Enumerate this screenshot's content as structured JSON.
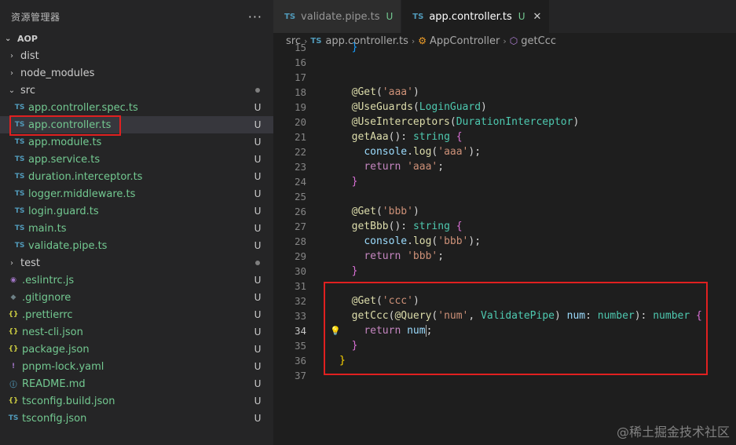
{
  "explorer": {
    "title": "资源管理器",
    "more": "···",
    "root": "AOP",
    "items": [
      {
        "chev": "›",
        "icon": "",
        "label": "dist",
        "status": "",
        "type": "folder"
      },
      {
        "chev": "›",
        "icon": "",
        "label": "node_modules",
        "status": "",
        "type": "folder"
      },
      {
        "chev": "⌄",
        "icon": "",
        "label": "src",
        "status": "dot",
        "type": "folder"
      },
      {
        "chev": "",
        "icon": "TS",
        "label": "app.controller.spec.ts",
        "status": "U",
        "type": "file"
      },
      {
        "chev": "",
        "icon": "TS",
        "label": "app.controller.ts",
        "status": "U",
        "type": "file"
      },
      {
        "chev": "",
        "icon": "TS",
        "label": "app.module.ts",
        "status": "U",
        "type": "file"
      },
      {
        "chev": "",
        "icon": "TS",
        "label": "app.service.ts",
        "status": "U",
        "type": "file"
      },
      {
        "chev": "",
        "icon": "TS",
        "label": "duration.interceptor.ts",
        "status": "U",
        "type": "file"
      },
      {
        "chev": "",
        "icon": "TS",
        "label": "logger.middleware.ts",
        "status": "U",
        "type": "file"
      },
      {
        "chev": "",
        "icon": "TS",
        "label": "login.guard.ts",
        "status": "U",
        "type": "file"
      },
      {
        "chev": "",
        "icon": "TS",
        "label": "main.ts",
        "status": "U",
        "type": "file"
      },
      {
        "chev": "",
        "icon": "TS",
        "label": "validate.pipe.ts",
        "status": "U",
        "type": "file"
      },
      {
        "chev": "›",
        "icon": "",
        "label": "test",
        "status": "dot",
        "type": "folder"
      },
      {
        "chev": "",
        "icon": "◉",
        "label": ".eslintrc.js",
        "status": "U",
        "type": "file"
      },
      {
        "chev": "",
        "icon": "◆",
        "label": ".gitignore",
        "status": "U",
        "type": "file"
      },
      {
        "chev": "",
        "icon": "{}",
        "label": ".prettierrc",
        "status": "U",
        "type": "file"
      },
      {
        "chev": "",
        "icon": "{}",
        "label": "nest-cli.json",
        "status": "U",
        "type": "file"
      },
      {
        "chev": "",
        "icon": "{}",
        "label": "package.json",
        "status": "U",
        "type": "file"
      },
      {
        "chev": "",
        "icon": "!",
        "label": "pnpm-lock.yaml",
        "status": "U",
        "type": "file"
      },
      {
        "chev": "",
        "icon": "ⓘ",
        "label": "README.md",
        "status": "U",
        "type": "file"
      },
      {
        "chev": "",
        "icon": "{}",
        "label": "tsconfig.build.json",
        "status": "U",
        "type": "file"
      },
      {
        "chev": "",
        "icon": "TS",
        "label": "tsconfig.json",
        "status": "U",
        "type": "file"
      }
    ]
  },
  "tabs": [
    {
      "icon": "TS",
      "label": "validate.pipe.ts",
      "status": "U",
      "active": false
    },
    {
      "icon": "TS",
      "label": "app.controller.ts",
      "status": "U",
      "active": true,
      "close": "✕"
    }
  ],
  "breadcrumb": {
    "folder": "src",
    "file_icon": "TS",
    "file": "app.controller.ts",
    "class_icon": "⚙",
    "class": "AppController",
    "method_icon": "⬡",
    "method": "getCcc"
  },
  "code_lines": [
    {
      "n": "15",
      "html": "  <span class=\"br3\">}</span>"
    },
    {
      "n": "16",
      "html": ""
    },
    {
      "n": "17",
      "html": ""
    },
    {
      "n": "18",
      "html": "  <span class=\"fn\">@Get</span>(<span class=\"str\">'aaa'</span>)"
    },
    {
      "n": "19",
      "html": "  <span class=\"fn\">@UseGuards</span>(<span class=\"ty\">LoginGuard</span>)"
    },
    {
      "n": "20",
      "html": "  <span class=\"fn\">@UseInterceptors</span>(<span class=\"ty\">DurationInterceptor</span>)"
    },
    {
      "n": "21",
      "html": "  <span class=\"fn\">getAaa</span>(): <span class=\"ty\">string</span> <span class=\"br2\">{</span>"
    },
    {
      "n": "22",
      "html": "    <span class=\"var\">console</span>.<span class=\"fn\">log</span>(<span class=\"str\">'aaa'</span>);"
    },
    {
      "n": "23",
      "html": "    <span class=\"kw\">return</span> <span class=\"str\">'aaa'</span>;"
    },
    {
      "n": "24",
      "html": "  <span class=\"br2\">}</span>"
    },
    {
      "n": "25",
      "html": ""
    },
    {
      "n": "26",
      "html": "  <span class=\"fn\">@Get</span>(<span class=\"str\">'bbb'</span>)"
    },
    {
      "n": "27",
      "html": "  <span class=\"fn\">getBbb</span>(): <span class=\"ty\">string</span> <span class=\"br2\">{</span>"
    },
    {
      "n": "28",
      "html": "    <span class=\"var\">console</span>.<span class=\"fn\">log</span>(<span class=\"str\">'bbb'</span>);"
    },
    {
      "n": "29",
      "html": "    <span class=\"kw\">return</span> <span class=\"str\">'bbb'</span>;"
    },
    {
      "n": "30",
      "html": "  <span class=\"br2\">}</span>"
    },
    {
      "n": "31",
      "html": ""
    },
    {
      "n": "32",
      "html": "  <span class=\"fn\">@Get</span>(<span class=\"str\">'ccc'</span>)"
    },
    {
      "n": "33",
      "html": "  <span class=\"fn\">getCcc</span>(<span class=\"fn\">@Query</span>(<span class=\"str\">'num'</span>, <span class=\"ty\">ValidatePipe</span>) <span class=\"var\">num</span>: <span class=\"ty\">number</span>): <span class=\"ty\">number</span> <span class=\"br2\">{</span>"
    },
    {
      "n": "34",
      "html": "    <span class=\"kw\">return</span> <span class=\"var\">num</span><span class=\"cursor\"></span>;",
      "current": true,
      "bulb": true
    },
    {
      "n": "35",
      "html": "  <span class=\"br2\">}</span>"
    },
    {
      "n": "36",
      "html": "<span class=\"br1\">}</span>"
    },
    {
      "n": "37",
      "html": ""
    }
  ],
  "watermark": "@稀土掘金技术社区",
  "colors": {
    "highlight_box": "#e02020",
    "untracked": "#73c991",
    "ts_icon": "#519aba"
  }
}
